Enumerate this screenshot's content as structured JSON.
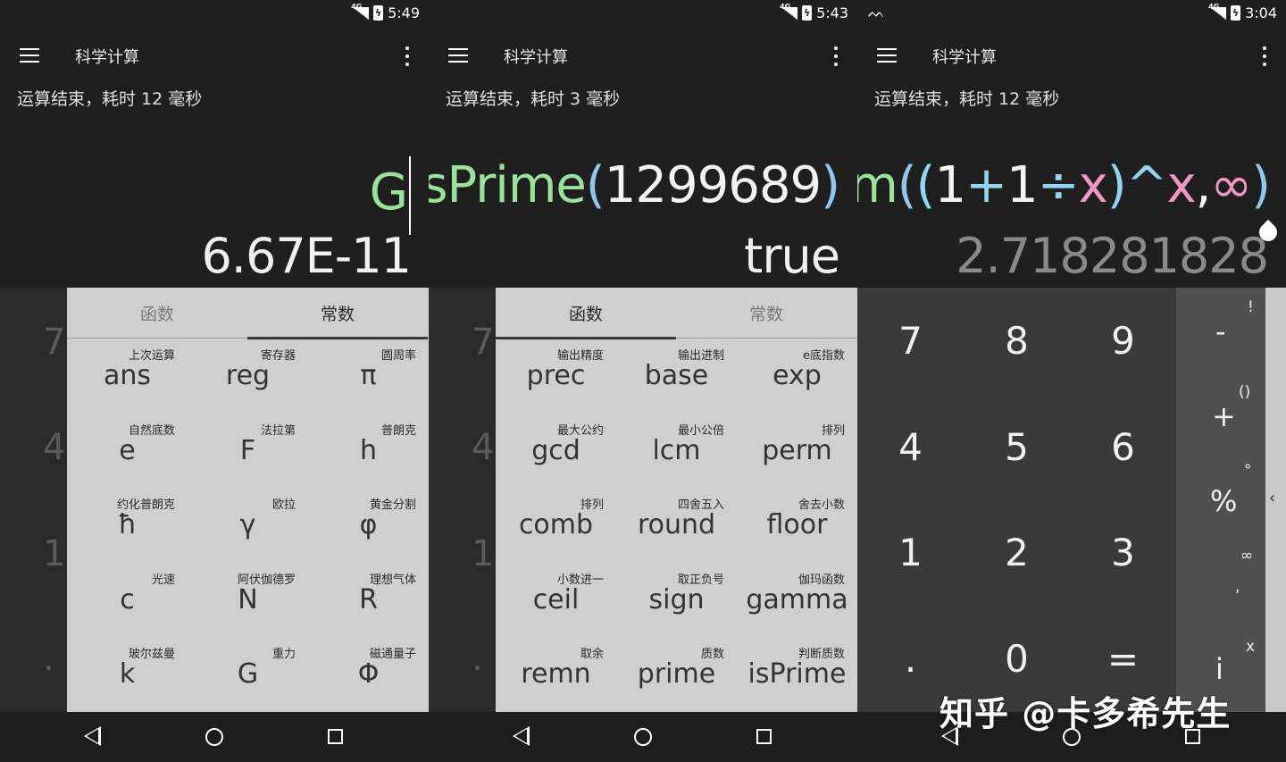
{
  "app": {
    "title": "科学计算"
  },
  "panels": [
    {
      "time": "5:49",
      "status_message": "运算结束，耗时 12 毫秒",
      "expression": "G",
      "result": "6.67E-11",
      "bg_keys": [
        "7",
        "4",
        "1",
        "."
      ],
      "tabs": {
        "left": "函数",
        "right": "常数",
        "active": "right"
      },
      "items": [
        {
          "sub": "上次运算",
          "main": "ans"
        },
        {
          "sub": "寄存器",
          "main": "reg"
        },
        {
          "sub": "圆周率",
          "main": "π"
        },
        {
          "sub": "自然底数",
          "main": "e"
        },
        {
          "sub": "法拉第",
          "main": "F"
        },
        {
          "sub": "普朗克",
          "main": "h"
        },
        {
          "sub": "约化普朗克",
          "main": "ħ"
        },
        {
          "sub": "欧拉",
          "main": "γ"
        },
        {
          "sub": "黄金分割",
          "main": "φ"
        },
        {
          "sub": "光速",
          "main": "c"
        },
        {
          "sub": "阿伏伽德罗",
          "main": "N"
        },
        {
          "sub": "理想气体",
          "main": "R"
        },
        {
          "sub": "玻尔兹曼",
          "main": "k"
        },
        {
          "sub": "重力",
          "main": "G"
        },
        {
          "sub": "磁通量子",
          "main": "Φ"
        }
      ]
    },
    {
      "time": "5:43",
      "status_message": "运算结束，耗时 3 毫秒",
      "expression_parts": [
        "isPrime",
        "(",
        "1299689",
        ")"
      ],
      "result": "true",
      "bg_keys": [
        "7",
        "4",
        "1",
        "."
      ],
      "tabs": {
        "left": "函数",
        "right": "常数",
        "active": "left"
      },
      "items": [
        {
          "sub": "输出精度",
          "main": "prec"
        },
        {
          "sub": "输出进制",
          "main": "base"
        },
        {
          "sub": "e底指数",
          "main": "exp"
        },
        {
          "sub": "最大公约",
          "main": "gcd"
        },
        {
          "sub": "最小公倍",
          "main": "lcm"
        },
        {
          "sub": "排列",
          "main": "perm"
        },
        {
          "sub": "排列",
          "main": "comb"
        },
        {
          "sub": "四舍五入",
          "main": "round"
        },
        {
          "sub": "舍去小数",
          "main": "floor"
        },
        {
          "sub": "小数进一",
          "main": "ceil"
        },
        {
          "sub": "取正负号",
          "main": "sign"
        },
        {
          "sub": "伽玛函数",
          "main": "gamma"
        },
        {
          "sub": "取余",
          "main": "remn"
        },
        {
          "sub": "质数",
          "main": "prime"
        },
        {
          "sub": "判断质数",
          "main": "isPrime"
        }
      ]
    },
    {
      "time": "3:04",
      "status_message": "运算结束，耗时 12 毫秒",
      "expression_parts": [
        "lim",
        "(",
        "(",
        "1",
        "+",
        "1",
        "÷",
        "x",
        ")",
        "^",
        "x",
        ",",
        "∞",
        ")"
      ],
      "result": "2.718281828",
      "numpad": [
        "7",
        "8",
        "9",
        "4",
        "5",
        "6",
        "1",
        "2",
        "3",
        ".",
        "0",
        "="
      ],
      "ops_large": [
        "-",
        "+",
        "%",
        "i"
      ],
      "ops_small": [
        "!",
        "()",
        "°",
        "∞",
        ",",
        "x"
      ],
      "drawer_handle": "‹"
    }
  ],
  "watermark": "知乎 @卡多希先生"
}
